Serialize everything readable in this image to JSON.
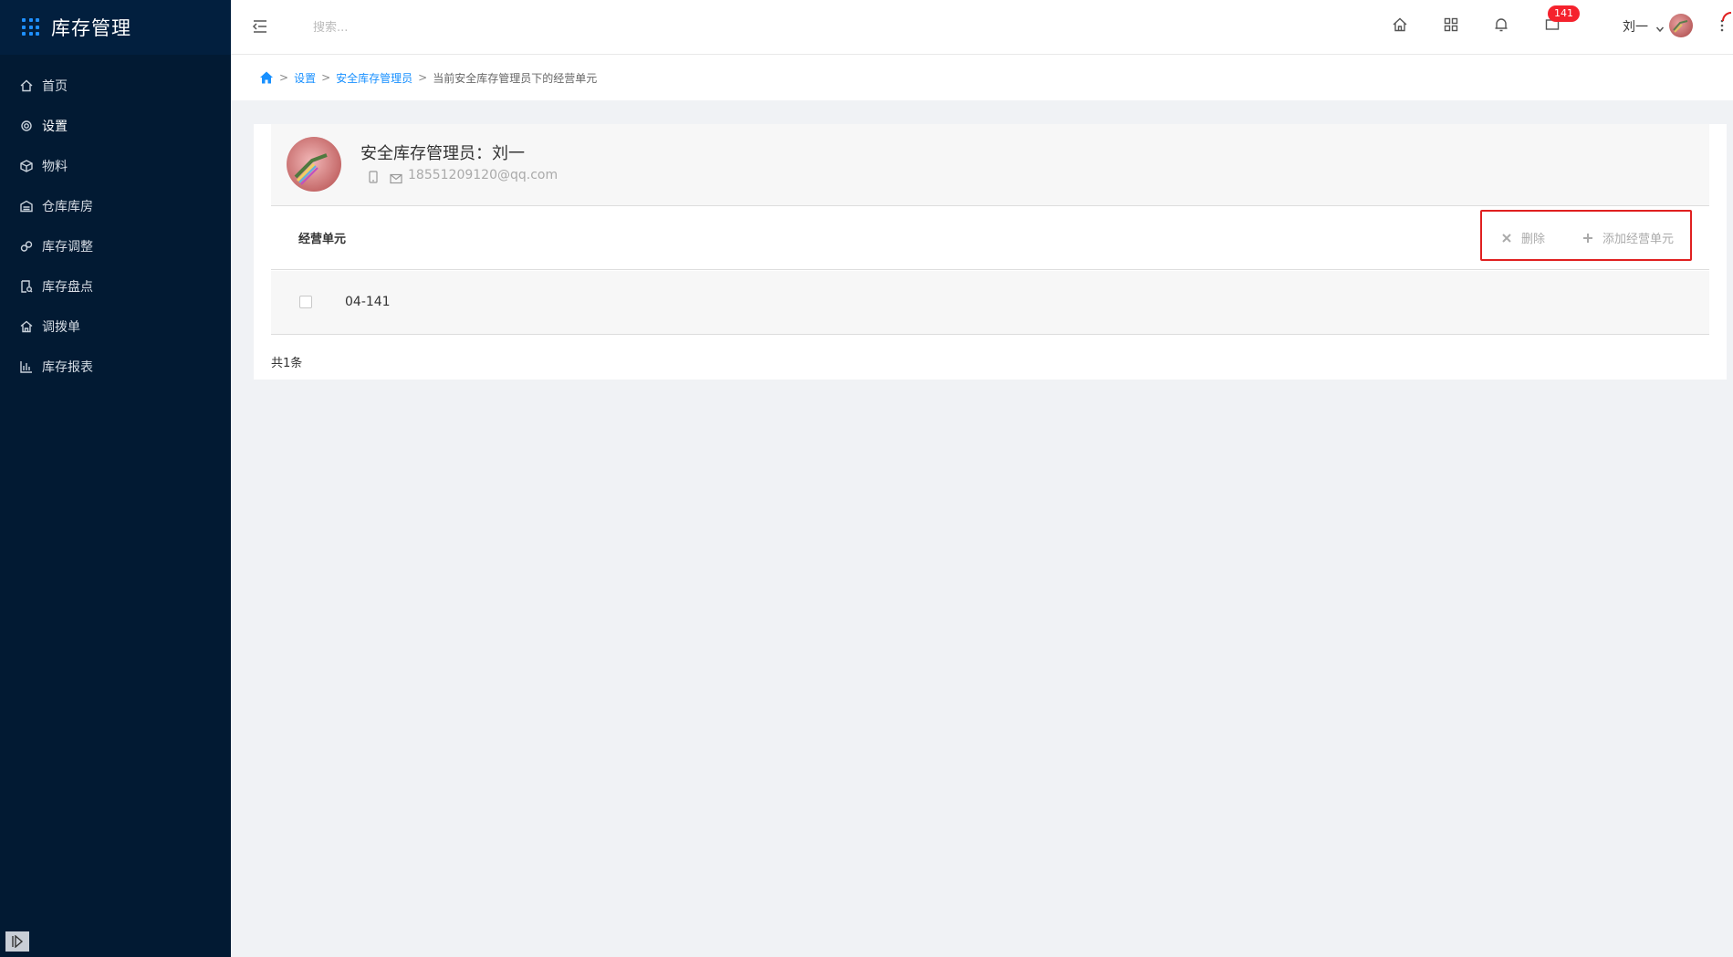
{
  "app": {
    "title": "库存管理"
  },
  "sidebar": {
    "items": [
      {
        "label": "首页",
        "icon": "home-icon"
      },
      {
        "label": "设置",
        "icon": "gear-icon"
      },
      {
        "label": "物料",
        "icon": "box-icon"
      },
      {
        "label": "仓库库房",
        "icon": "warehouse-icon"
      },
      {
        "label": "库存调整",
        "icon": "adjust-icon"
      },
      {
        "label": "库存盘点",
        "icon": "inventory-icon"
      },
      {
        "label": "调拨单",
        "icon": "transfer-icon"
      },
      {
        "label": "库存报表",
        "icon": "bar-chart-icon"
      }
    ]
  },
  "header": {
    "search_placeholder": "搜索...",
    "notification_count": "141",
    "user_name": "刘一"
  },
  "breadcrumb": {
    "items": [
      "设置",
      "安全库存管理员"
    ],
    "current": "当前安全库存管理员下的经营单元"
  },
  "profile": {
    "title": "安全库存管理员：刘一",
    "email": "18551209120@qq.com"
  },
  "section": {
    "title": "经营单元",
    "delete_label": "删除",
    "add_label": "添加经营单元"
  },
  "table": {
    "rows": [
      {
        "value": "04-141"
      }
    ]
  },
  "footer": {
    "total": "共1条"
  },
  "colors": {
    "sidebar_bg": "#021a33",
    "accent": "#1890ff",
    "badge": "#f5222d",
    "highlight_box": "#e02020"
  }
}
